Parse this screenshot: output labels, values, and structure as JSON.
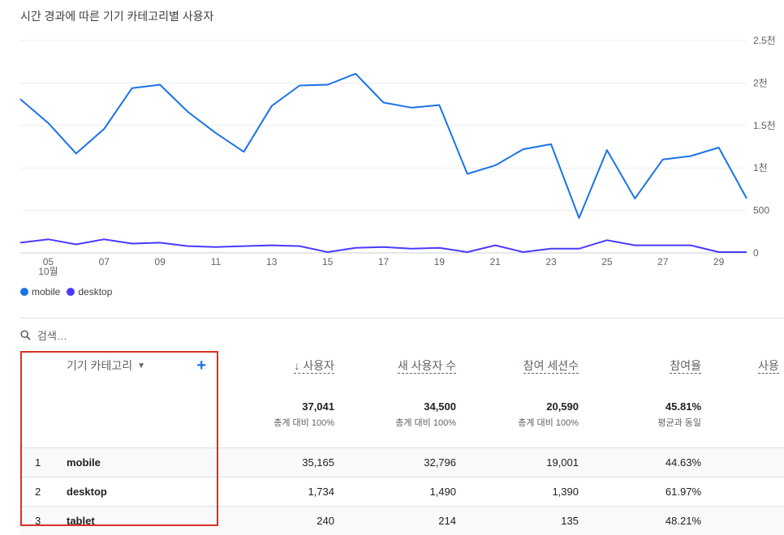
{
  "title": "시간 경과에 따른 기기 카테고리별 사용자",
  "legend": {
    "mobile_label": "mobile",
    "desktop_label": "desktop"
  },
  "search": {
    "placeholder": "검색…"
  },
  "table": {
    "dimension_header": "기기 카테고리",
    "metric_headers": [
      "↓ 사용자",
      "새 사용자 수",
      "참여 세션수",
      "참여율",
      "사용"
    ],
    "totals": {
      "values": [
        "37,041",
        "34,500",
        "20,590",
        "45.81%"
      ],
      "subs": [
        "총계 대비 100%",
        "총계 대비 100%",
        "총계 대비 100%",
        "평균과 동일"
      ]
    },
    "rows": [
      {
        "index": "1",
        "category": "mobile",
        "users": "35,165",
        "new_users": "32,796",
        "engaged_sessions": "19,001",
        "engagement_rate": "44.63%"
      },
      {
        "index": "2",
        "category": "desktop",
        "users": "1,734",
        "new_users": "1,490",
        "engaged_sessions": "1,390",
        "engagement_rate": "61.97%"
      },
      {
        "index": "3",
        "category": "tablet",
        "users": "240",
        "new_users": "214",
        "engaged_sessions": "135",
        "engagement_rate": "48.21%"
      }
    ]
  },
  "colors": {
    "mobile": "#1a73e8",
    "desktop": "#4a3aff",
    "grid": "#ececec",
    "highlight": "#d93025"
  },
  "chart_data": {
    "type": "line",
    "title": "시간 경과에 따른 기기 카테고리별 사용자",
    "x": [
      4,
      5,
      6,
      7,
      8,
      9,
      10,
      11,
      12,
      13,
      14,
      15,
      16,
      17,
      18,
      19,
      20,
      21,
      22,
      23,
      24,
      25,
      26,
      27,
      28,
      29,
      30
    ],
    "x_tick_labels": [
      "05",
      "07",
      "09",
      "11",
      "13",
      "15",
      "17",
      "19",
      "21",
      "23",
      "25",
      "27",
      "29"
    ],
    "x_tick_values": [
      5,
      7,
      9,
      11,
      13,
      15,
      17,
      19,
      21,
      23,
      25,
      27,
      29
    ],
    "x_month_label": "10월",
    "y_tick_labels": [
      "0",
      "500",
      "1천",
      "1.5천",
      "2천",
      "2.5천"
    ],
    "y_tick_values": [
      0,
      500,
      1000,
      1500,
      2000,
      2500
    ],
    "ylim": [
      0,
      2500
    ],
    "y_axis_position": "right",
    "grid": true,
    "legend_position": "bottom-left",
    "series": [
      {
        "name": "mobile",
        "values": [
          1810,
          1530,
          1170,
          1460,
          1940,
          1980,
          1660,
          1410,
          1190,
          1730,
          1970,
          1980,
          2110,
          1770,
          1710,
          1740,
          930,
          1030,
          1220,
          1280,
          410,
          1210,
          640,
          1100,
          1140,
          1240,
          640
        ]
      },
      {
        "name": "desktop",
        "values": [
          120,
          160,
          100,
          160,
          110,
          120,
          80,
          70,
          80,
          90,
          80,
          10,
          60,
          70,
          50,
          60,
          10,
          90,
          10,
          50,
          50,
          150,
          90,
          90,
          90,
          10,
          10
        ]
      }
    ]
  }
}
